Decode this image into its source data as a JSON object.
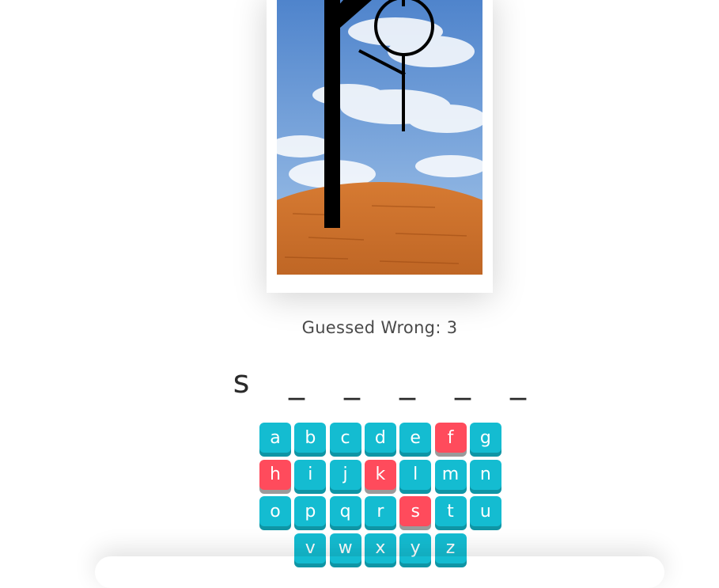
{
  "status": {
    "label": "Guessed Wrong:",
    "count": "3"
  },
  "word": {
    "slots": [
      "s",
      "_",
      "_",
      "_",
      "_",
      "_"
    ]
  },
  "keyboard": {
    "letters": [
      "a",
      "b",
      "c",
      "d",
      "e",
      "f",
      "g",
      "h",
      "i",
      "j",
      "k",
      "l",
      "m",
      "n",
      "o",
      "p",
      "q",
      "r",
      "s",
      "t",
      "u",
      "v",
      "w",
      "x",
      "y",
      "z"
    ],
    "used": [
      "f",
      "h",
      "k",
      "s"
    ]
  },
  "colors": {
    "key": "#14bcd1",
    "key_shadow": "#0f95a5",
    "used_key": "#ff4b5c",
    "used_shadow": "#9a9a9a"
  },
  "icons": {
    "scene": "hangman-scene"
  }
}
